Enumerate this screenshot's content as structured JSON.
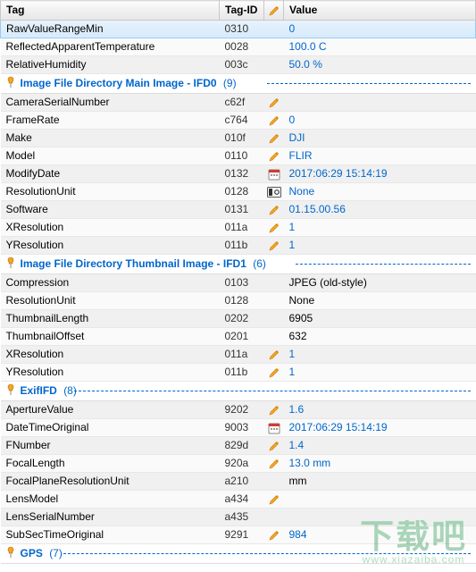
{
  "headers": {
    "tag": "Tag",
    "tagId": "Tag-ID",
    "icon": "pencil",
    "value": "Value"
  },
  "groups": [
    {
      "title": "Image File Directory Main Image - IFD0",
      "count": "(9)",
      "prefix_rows": [
        {
          "tag": "RawValueRangeMin",
          "id": "0310",
          "icon": null,
          "value": "0",
          "style": "link",
          "selected": true
        },
        {
          "tag": "ReflectedApparentTemperature",
          "id": "0028",
          "icon": null,
          "value": "100.0 C",
          "style": "link"
        },
        {
          "tag": "RelativeHumidity",
          "id": "003c",
          "icon": null,
          "value": "50.0 %",
          "style": "link"
        }
      ],
      "rows": [
        {
          "tag": "CameraSerialNumber",
          "id": "c62f",
          "icon": "pencil",
          "value": "",
          "style": "plain"
        },
        {
          "tag": "FrameRate",
          "id": "c764",
          "icon": "pencil",
          "value": "0",
          "style": "link"
        },
        {
          "tag": "Make",
          "id": "010f",
          "icon": "pencil",
          "value": "DJI",
          "style": "link"
        },
        {
          "tag": "Model",
          "id": "0110",
          "icon": "pencil",
          "value": "FLIR",
          "style": "link"
        },
        {
          "tag": "ModifyDate",
          "id": "0132",
          "icon": "calendar",
          "value": "2017:06:29 15:14:19",
          "style": "link"
        },
        {
          "tag": "ResolutionUnit",
          "id": "0128",
          "icon": "unit",
          "value": "None",
          "style": "link"
        },
        {
          "tag": "Software",
          "id": "0131",
          "icon": "pencil",
          "value": "01.15.00.56",
          "style": "link"
        },
        {
          "tag": "XResolution",
          "id": "011a",
          "icon": "pencil",
          "value": "1",
          "style": "link"
        },
        {
          "tag": "YResolution",
          "id": "011b",
          "icon": "pencil",
          "value": "1",
          "style": "link"
        }
      ]
    },
    {
      "title": "Image File Directory Thumbnail Image - IFD1",
      "count": "(6)",
      "rows": [
        {
          "tag": "Compression",
          "id": "0103",
          "icon": null,
          "value": "JPEG (old-style)",
          "style": "plain"
        },
        {
          "tag": "ResolutionUnit",
          "id": "0128",
          "icon": null,
          "value": "None",
          "style": "plain"
        },
        {
          "tag": "ThumbnailLength",
          "id": "0202",
          "icon": null,
          "value": "6905",
          "style": "plain"
        },
        {
          "tag": "ThumbnailOffset",
          "id": "0201",
          "icon": null,
          "value": "632",
          "style": "plain"
        },
        {
          "tag": "XResolution",
          "id": "011a",
          "icon": "pencil",
          "value": "1",
          "style": "link"
        },
        {
          "tag": "YResolution",
          "id": "011b",
          "icon": "pencil",
          "value": "1",
          "style": "link"
        }
      ]
    },
    {
      "title": "ExifIFD",
      "count": "(8)",
      "rows": [
        {
          "tag": "ApertureValue",
          "id": "9202",
          "icon": "pencil",
          "value": "1.6",
          "style": "link"
        },
        {
          "tag": "DateTimeOriginal",
          "id": "9003",
          "icon": "calendar",
          "value": "2017:06:29 15:14:19",
          "style": "link"
        },
        {
          "tag": "FNumber",
          "id": "829d",
          "icon": "pencil",
          "value": "1.4",
          "style": "link"
        },
        {
          "tag": "FocalLength",
          "id": "920a",
          "icon": "pencil",
          "value": "13.0 mm",
          "style": "link"
        },
        {
          "tag": "FocalPlaneResolutionUnit",
          "id": "a210",
          "icon": null,
          "value": "mm",
          "style": "plain"
        },
        {
          "tag": "LensModel",
          "id": "a434",
          "icon": "pencil",
          "value": "",
          "style": "plain"
        },
        {
          "tag": "LensSerialNumber",
          "id": "a435",
          "icon": null,
          "value": "",
          "style": "plain"
        },
        {
          "tag": "SubSecTimeOriginal",
          "id": "9291",
          "icon": "pencil",
          "value": "984",
          "style": "link"
        }
      ]
    },
    {
      "title": "GPS",
      "count": "(7)",
      "rows": []
    }
  ],
  "watermark": {
    "main": "下载吧",
    "sub": "www.xiazaiba.com"
  }
}
